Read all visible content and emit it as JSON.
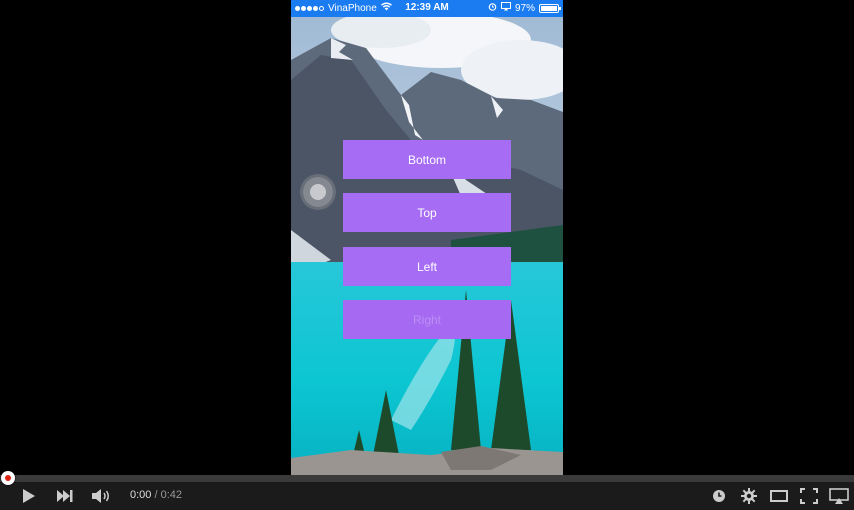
{
  "status_bar": {
    "carrier": "VinaPhone",
    "time": "12:39 AM",
    "battery_text": "97%",
    "battery_level": 0.97,
    "signal_bars": 5,
    "signal_filled": 4,
    "icons": [
      "wifi-icon",
      "alarm-icon",
      "screen-mirroring-icon",
      "battery-icon"
    ]
  },
  "menu": {
    "buttons": [
      {
        "label": "Bottom"
      },
      {
        "label": "Top"
      },
      {
        "label": "Left"
      },
      {
        "label": "Right",
        "faded": true
      }
    ]
  },
  "player": {
    "current_time": "0:00",
    "separator": " / ",
    "duration": "0:42",
    "progress": 0.0,
    "accent_color": "#dd2222",
    "icons": [
      "play-icon",
      "next-icon",
      "volume-icon",
      "watch-later-icon",
      "settings-icon",
      "theater-mode-icon",
      "fullscreen-icon",
      "airplay-icon"
    ]
  },
  "colors": {
    "status_bar": "#1a7cf0",
    "button_bg": "#a66cf4",
    "lake": "#17c4d0",
    "sky": "#cfe0ee"
  }
}
